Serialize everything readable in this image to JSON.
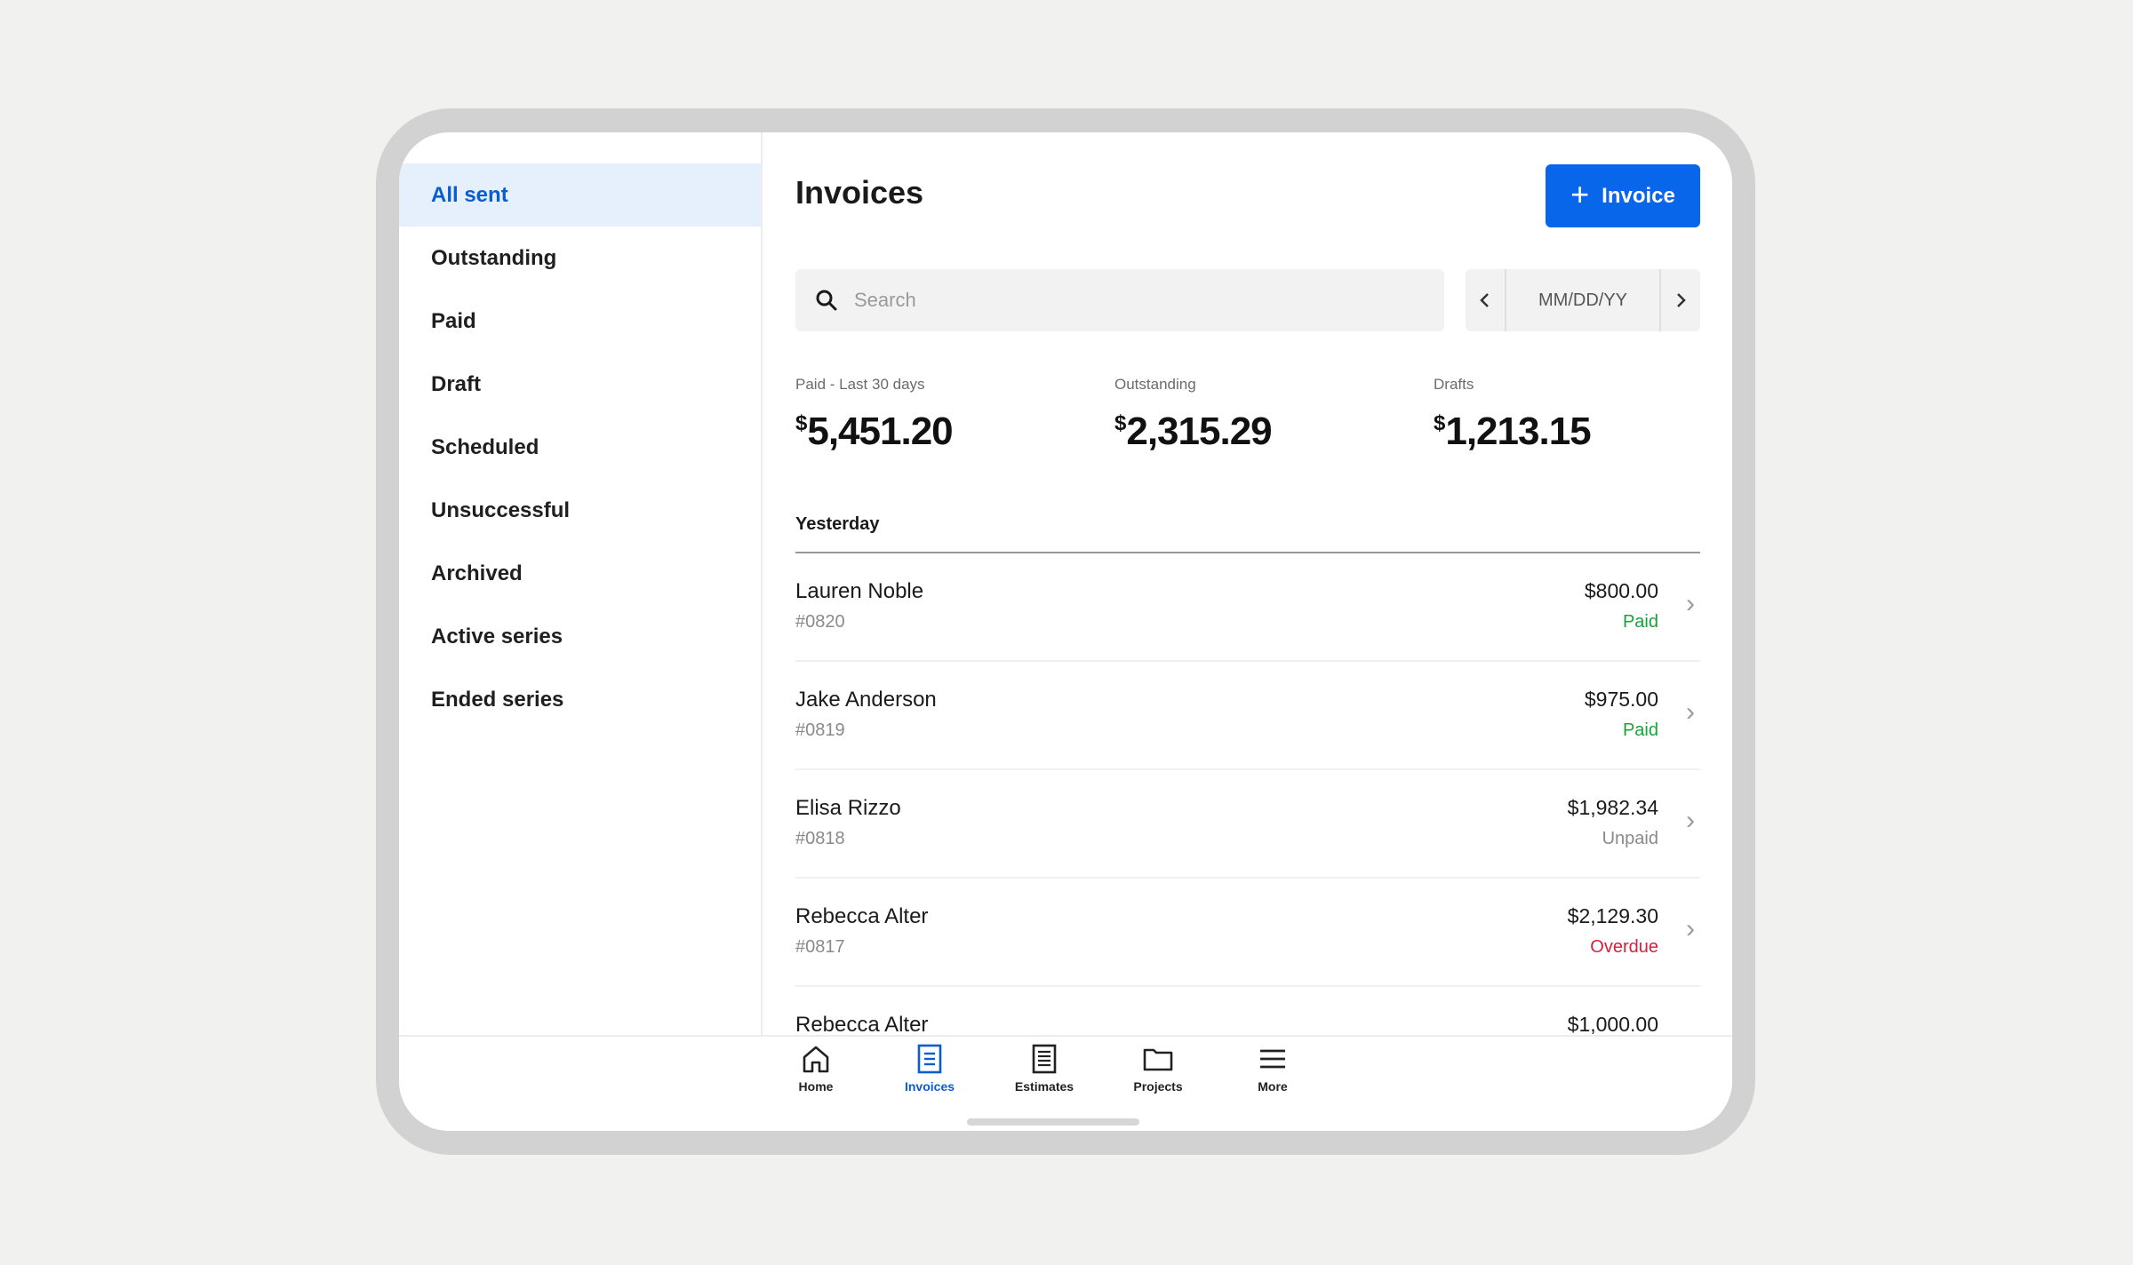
{
  "sidebar": {
    "items": [
      {
        "label": "All sent",
        "active": true
      },
      {
        "label": "Outstanding"
      },
      {
        "label": "Paid"
      },
      {
        "label": "Draft"
      },
      {
        "label": "Scheduled"
      },
      {
        "label": "Unsuccessful"
      },
      {
        "label": "Archived"
      },
      {
        "label": "Active series"
      },
      {
        "label": "Ended series"
      }
    ]
  },
  "header": {
    "title": "Invoices",
    "new_button_label": "Invoice",
    "new_button_icon": "plus-icon"
  },
  "search": {
    "placeholder": "Search",
    "value": ""
  },
  "date_filter": {
    "label": "MM/DD/YY",
    "prev_icon": "chevron-left-icon",
    "next_icon": "chevron-right-icon"
  },
  "stats": [
    {
      "label": "Paid - Last 30 days",
      "currency": "$",
      "value": "5,451.20"
    },
    {
      "label": "Outstanding",
      "currency": "$",
      "value": "2,315.29"
    },
    {
      "label": "Drafts",
      "currency": "$",
      "value": "1,213.15"
    }
  ],
  "list": {
    "section_title": "Yesterday",
    "rows": [
      {
        "name": "Lauren Noble",
        "number": "#0820",
        "amount": "$800.00",
        "status": "Paid"
      },
      {
        "name": "Jake Anderson",
        "number": "#0819",
        "amount": "$975.00",
        "status": "Paid"
      },
      {
        "name": "Elisa Rizzo",
        "number": "#0818",
        "amount": "$1,982.34",
        "status": "Unpaid"
      },
      {
        "name": "Rebecca Alter",
        "number": "#0817",
        "amount": "$2,129.30",
        "status": "Overdue"
      },
      {
        "name": "Rebecca Alter",
        "number": "",
        "amount": "$1,000.00",
        "status": ""
      }
    ]
  },
  "tabbar": {
    "tabs": [
      {
        "label": "Home",
        "icon": "home-icon"
      },
      {
        "label": "Invoices",
        "icon": "invoice-icon",
        "active": true
      },
      {
        "label": "Estimates",
        "icon": "estimate-icon"
      },
      {
        "label": "Projects",
        "icon": "folder-icon"
      },
      {
        "label": "More",
        "icon": "menu-icon"
      }
    ]
  },
  "colors": {
    "accent": "#0866ea",
    "active_bg": "#e6f0fc",
    "paid": "#15a33a",
    "unpaid": "#8a8a8a",
    "overdue": "#d4203f"
  }
}
